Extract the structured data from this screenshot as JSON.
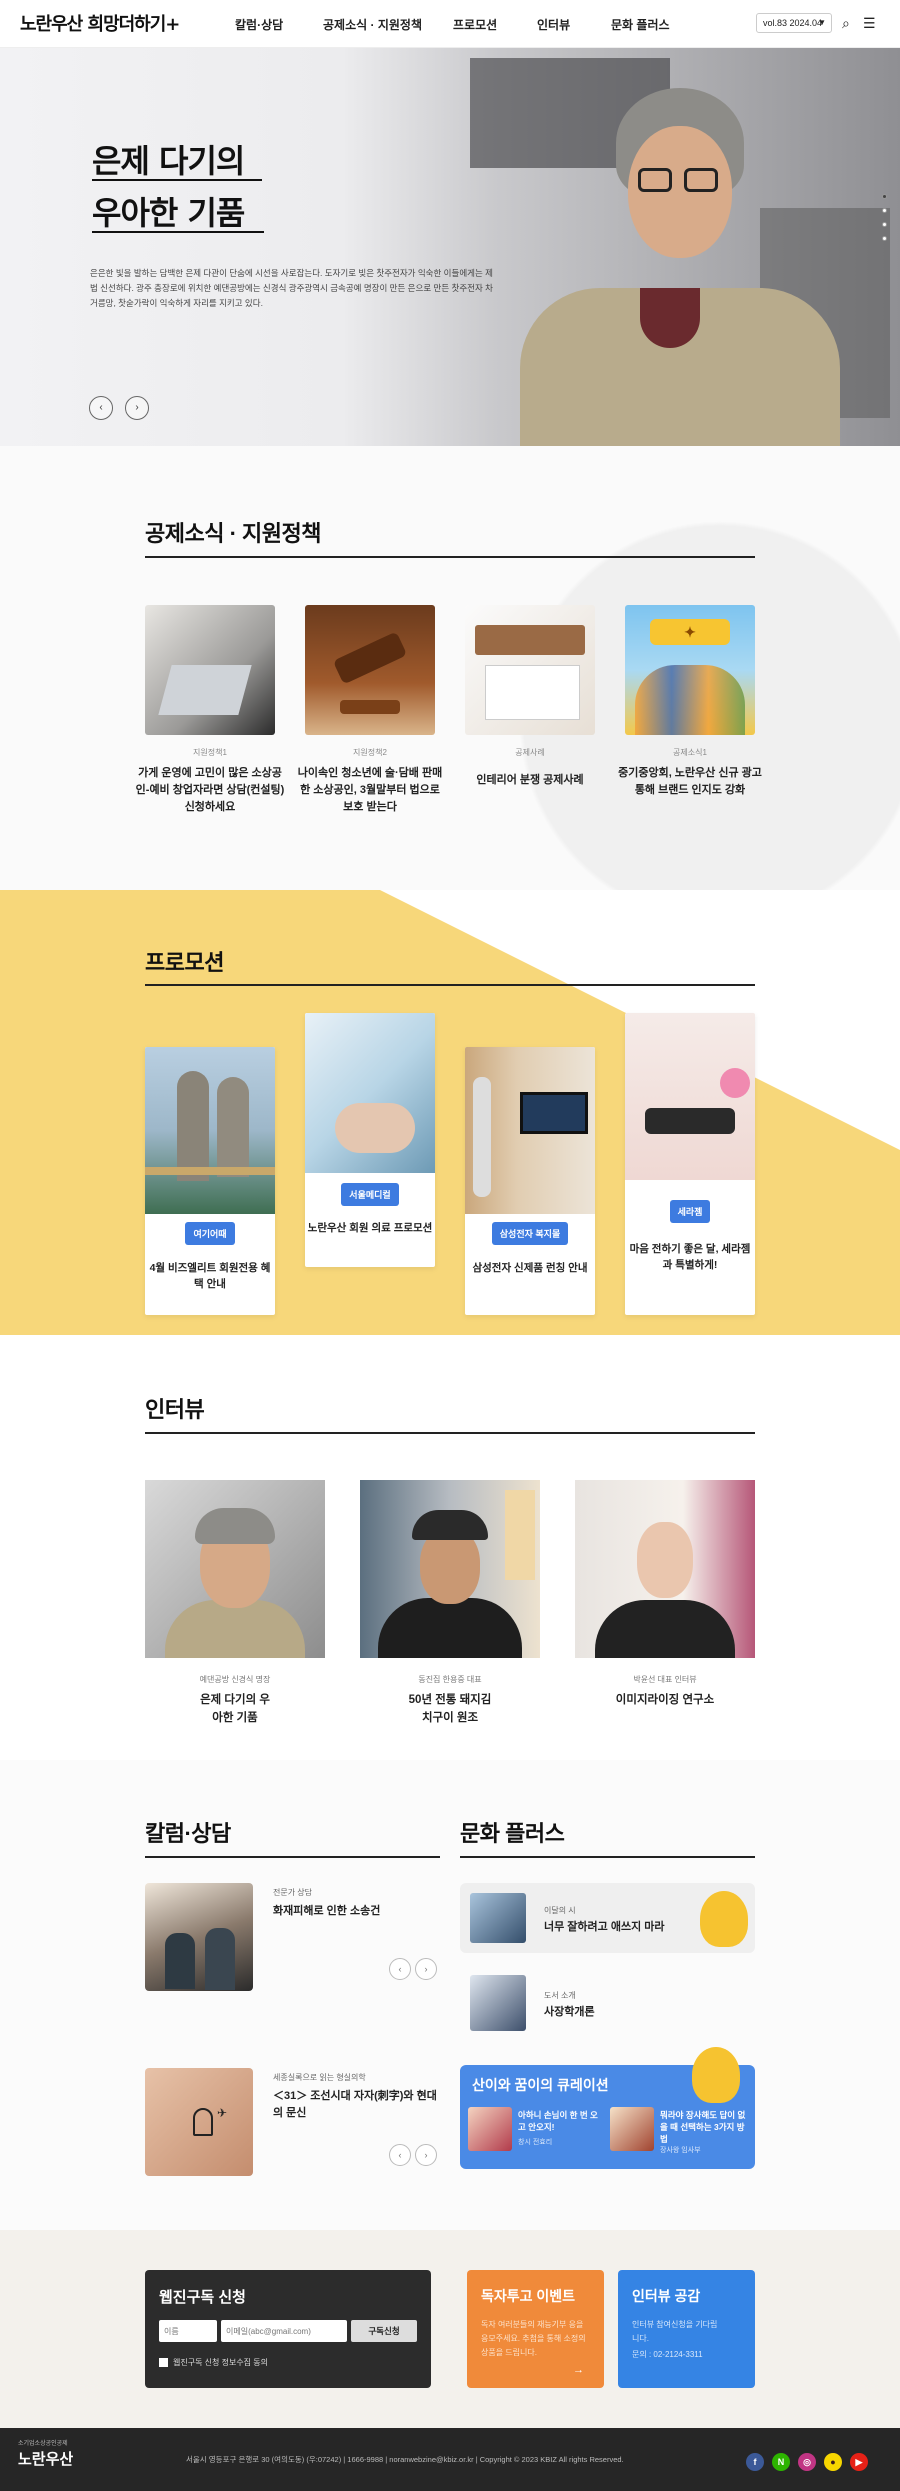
{
  "header": {
    "logo": "노란우산 희망더하기+",
    "nav": [
      "칼럼·상담",
      "공제소식 · 지원정책",
      "프로모션",
      "인터뷰",
      "문화 플러스"
    ],
    "volume": "vol.83 2024.04"
  },
  "hero": {
    "title_line1": "은제 다기의",
    "title_line2": "우아한 기품",
    "description": "은은한 빛을 발하는 담백한 은제 다관이 단숨에 시선을 사로잡는다. 도자기로 빚은 찻주전자가 익숙한 이들에게는 제법 신선하다. 광주 충장로에 위치한 예댄공방에는 신경식 광주광역시 금속공예 명장이 만든 은으로 만든 찻주전자 차 거름망, 찻숟가락이 익숙하게 자리를 지키고 있다."
  },
  "notice": {
    "title": "공제소식 · 지원정책",
    "items": [
      {
        "category": "지원정책1",
        "title": "가게 운영에 고민이 많은 소상공인-예비 창업자라면 상담(컨설팅)신청하세요"
      },
      {
        "category": "지원정책2",
        "title": "나이속인 청소년에 술·담배 판매한 소상공인, 3월말부터 법으로 보호 받는다"
      },
      {
        "category": "공제사례",
        "title": "인테리어 분쟁 공제사례"
      },
      {
        "category": "공제소식1",
        "title": "중기중앙회, 노란우산 신규 광고 통해 브랜드 인지도 강화"
      }
    ]
  },
  "promotion": {
    "title": "프로모션",
    "items": [
      {
        "badge": "여기어때",
        "title": "4월 비즈엘리트 회원전용 혜택 안내"
      },
      {
        "badge": "서울메디컬",
        "title": "노란우산 회원 의료 프로모션"
      },
      {
        "badge": "삼성전자 복지몰",
        "title": "삼성전자 신제품 런칭 안내"
      },
      {
        "badge": "세라젬",
        "title": "마음 전하기 좋은 달, 세라젬과 특별하게!"
      }
    ]
  },
  "interview": {
    "title": "인터뷰",
    "items": [
      {
        "role": "예댄공방 신경식 명장",
        "title": "은제 다기의 우아한 기품"
      },
      {
        "role": "동진집 한용중 대표",
        "title": "50년 전통 돼지김치구이 원조"
      },
      {
        "role": "박윤선 대표 인터뷰",
        "title": "이미지라이징 연구소"
      }
    ]
  },
  "column": {
    "title": "칼럼·상담",
    "items": [
      {
        "category": "전문가 상담",
        "title": "화재피해로 인한 소송건"
      },
      {
        "category": "세종실록으로 읽는 형실의학",
        "title": "＜31＞ 조선시대 자자(刺字)와 현대의 문신"
      }
    ]
  },
  "culture": {
    "title": "문화 플러스",
    "items": [
      {
        "category": "이달의 시",
        "title": "너무 잘하려고 애쓰지 마라"
      },
      {
        "category": "도서 소개",
        "title": "사장학개론"
      }
    ],
    "curation": {
      "title": "산이와 꿈이의 큐레이션",
      "items": [
        {
          "text": "아하니 손님이 한 번 오고 안오지!",
          "sub": "창시 전효리"
        },
        {
          "text": "뭐라야 장사해도 답이 없을 때 선택하는 3가지 방법",
          "sub": "장사왕 임사부"
        }
      ]
    }
  },
  "subscribe": {
    "title": "웹진구독 신청",
    "name_placeholder": "이름",
    "email_placeholder": "이메일(abc@gmail.com)",
    "button": "구독신청",
    "agree": "웹진구독 신청 정보수집 동의"
  },
  "event": {
    "title": "독자투고 이벤트",
    "text": "독자 여러분들의 재능기부 응을 응모주세요. 추첨을 통해 소정의 상품을 드립니다."
  },
  "interview_box": {
    "title": "인터뷰 공감",
    "text": "인터뷰 참여신청을 기다립니다.",
    "phone": "문의 : 02-2124-3311"
  },
  "footer": {
    "logo": "노란우산",
    "logo_sub": "소기업소상공인공제",
    "info": "서울시 영등포구 은행로 30 (여의도동) (우:07242)  |  1666-9988  |  noranwebzine@kbiz.or.kr  |  Copyright © 2023 KBIZ All rights Reserved.",
    "socials": [
      "f",
      "N",
      "◎",
      "●",
      "▶"
    ]
  },
  "colors": {
    "accent": "#3d7be0",
    "yellow": "#f7d77a",
    "orange": "#f08a3a",
    "blue": "#3584e4",
    "dark": "#2c2c2c"
  }
}
